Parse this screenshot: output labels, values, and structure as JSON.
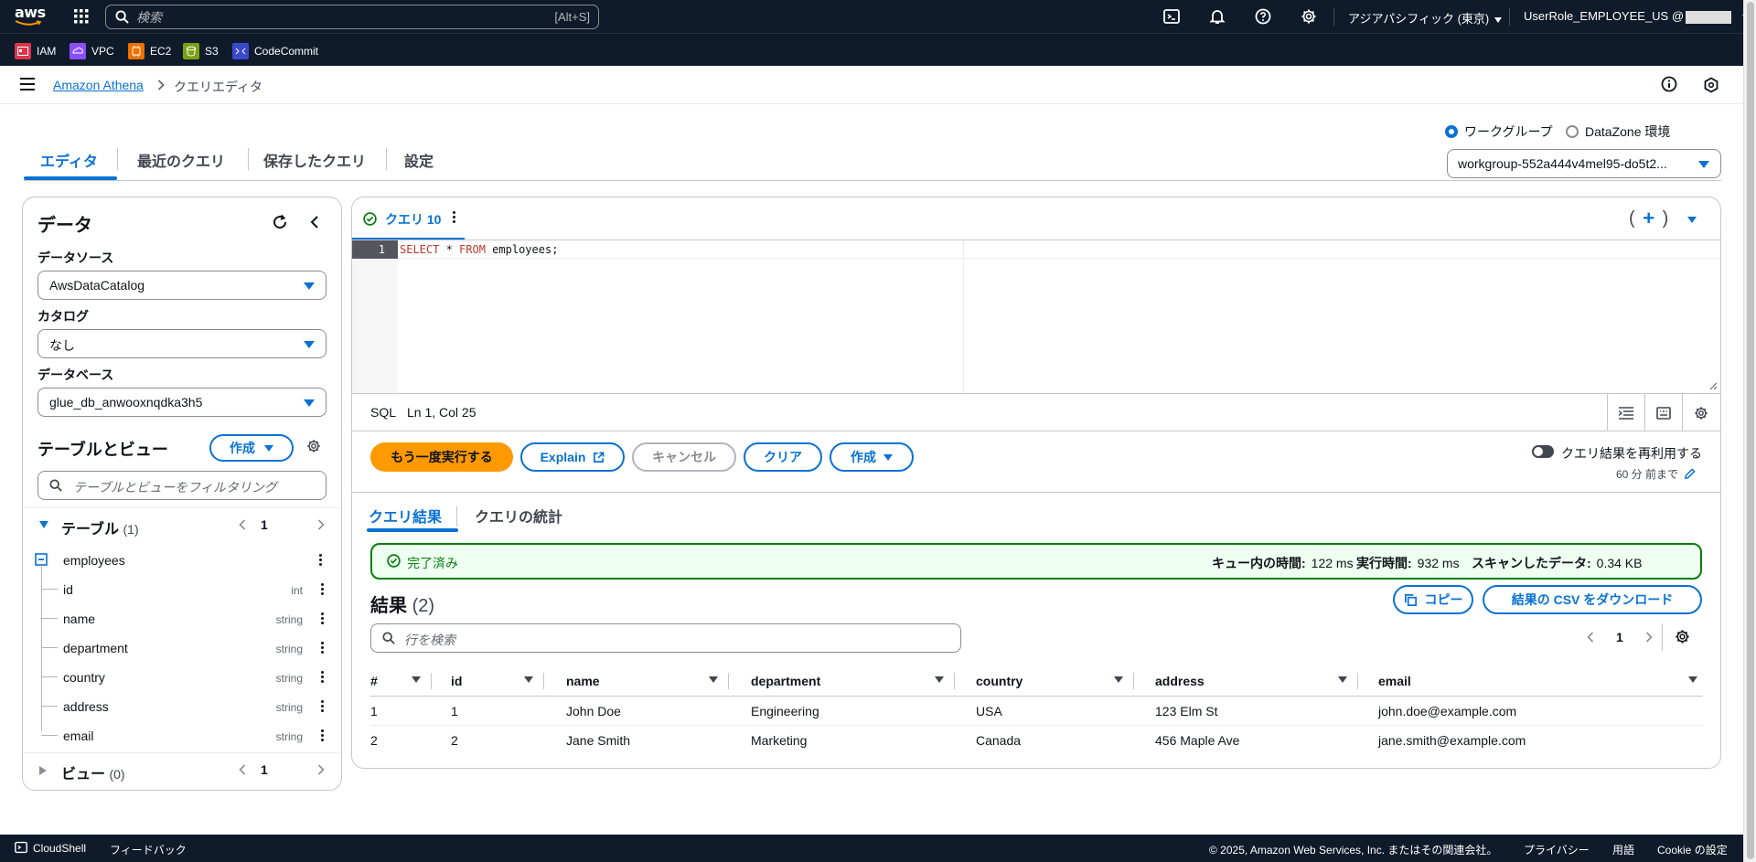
{
  "topnav": {
    "logo": "aws",
    "search_placeholder": "検索",
    "search_shortcut": "[Alt+S]",
    "region": "アジアパシフィック (東京)",
    "user": "UserRole_EMPLOYEE_US @"
  },
  "favorites": [
    {
      "label": "IAM",
      "color": "#dd344c"
    },
    {
      "label": "VPC",
      "color": "#8c4fff"
    },
    {
      "label": "EC2",
      "color": "#ed7100"
    },
    {
      "label": "S3",
      "color": "#7aa116"
    },
    {
      "label": "CodeCommit",
      "color": "#c925d1"
    }
  ],
  "breadcrumb": {
    "root": "Amazon Athena",
    "current": "クエリエディタ"
  },
  "tabs": {
    "editor": "エディタ",
    "recent": "最近のクエリ",
    "saved": "保存したクエリ",
    "settings": "設定"
  },
  "workgroup": {
    "radio_workgroup": "ワークグループ",
    "radio_datazone": "DataZone 環境",
    "selected": "workgroup-552a444v4mel95-do5t2..."
  },
  "data_panel": {
    "title": "データ",
    "datasource_label": "データソース",
    "datasource_value": "AwsDataCatalog",
    "catalog_label": "カタログ",
    "catalog_value": "なし",
    "database_label": "データベース",
    "database_value": "glue_db_anwooxnqdka3h5",
    "tables_views_title": "テーブルとビュー",
    "create_label": "作成",
    "filter_placeholder": "テーブルとビューをフィルタリング",
    "tables_section": "テーブル",
    "tables_count": "(1)",
    "tables_page": "1",
    "table_name": "employees",
    "columns": [
      {
        "name": "id",
        "type": "int"
      },
      {
        "name": "name",
        "type": "string"
      },
      {
        "name": "department",
        "type": "string"
      },
      {
        "name": "country",
        "type": "string"
      },
      {
        "name": "address",
        "type": "string"
      },
      {
        "name": "email",
        "type": "string"
      }
    ],
    "views_section": "ビュー",
    "views_count": "(0)",
    "views_page": "1"
  },
  "editor": {
    "query_tab": "クエリ 10",
    "line_number": "1",
    "code_kw1": "SELECT",
    "code_mid": " * ",
    "code_kw2": "FROM",
    "code_rest": " employees;",
    "lang": "SQL",
    "position": "Ln 1, Col 25"
  },
  "actions": {
    "run_again": "もう一度実行する",
    "explain": "Explain",
    "cancel": "キャンセル",
    "clear": "クリア",
    "create": "作成",
    "reuse_label": "クエリ結果を再利用する",
    "reuse_sub": "60 分 前まで"
  },
  "results": {
    "tab_results": "クエリ結果",
    "tab_stats": "クエリの統計",
    "status": "完了済み",
    "queue_label": "キュー内の時間:",
    "queue_value": "122 ms",
    "run_label": "実行時間:",
    "run_value": "932 ms",
    "scan_label": "スキャンしたデータ:",
    "scan_value": "0.34 KB",
    "title": "結果",
    "count": "(2)",
    "copy_label": "コピー",
    "download_label": "結果の CSV をダウンロード",
    "search_placeholder": "行を検索",
    "page": "1",
    "columns": [
      "#",
      "id",
      "name",
      "department",
      "country",
      "address",
      "email"
    ],
    "rows": [
      [
        "1",
        "1",
        "John Doe",
        "Engineering",
        "USA",
        "123 Elm St",
        "john.doe@example.com"
      ],
      [
        "2",
        "2",
        "Jane Smith",
        "Marketing",
        "Canada",
        "456 Maple Ave",
        "jane.smith@example.com"
      ]
    ]
  },
  "footer": {
    "cloudshell": "CloudShell",
    "feedback": "フィードバック",
    "copyright": "© 2025, Amazon Web Services, Inc. またはその関連会社。",
    "privacy": "プライバシー",
    "terms": "用語",
    "cookie": "Cookie の設定"
  }
}
